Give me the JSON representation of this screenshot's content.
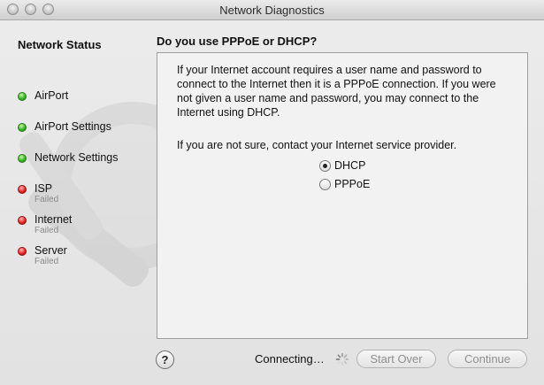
{
  "window": {
    "title": "Network Diagnostics"
  },
  "sidebar": {
    "header": "Network Status",
    "items": [
      {
        "label": "AirPort",
        "status": "ok",
        "sub": ""
      },
      {
        "label": "AirPort Settings",
        "status": "ok",
        "sub": ""
      },
      {
        "label": "Network Settings",
        "status": "ok",
        "sub": ""
      },
      {
        "label": "ISP",
        "status": "failed",
        "sub": "Failed"
      },
      {
        "label": "Internet",
        "status": "failed",
        "sub": "Failed"
      },
      {
        "label": "Server",
        "status": "failed",
        "sub": "Failed"
      }
    ]
  },
  "main": {
    "heading": "Do you use PPPoE or DHCP?",
    "paragraph1": "If your Internet account requires a user name and password to connect to the Internet then it is a PPPoE connection. If you were not given a user name and password, you may connect to the Internet using DHCP.",
    "paragraph2": "If you are not sure, contact your Internet service provider.",
    "options": [
      {
        "label": "DHCP",
        "selected": true
      },
      {
        "label": "PPPoE",
        "selected": false
      }
    ]
  },
  "footer": {
    "help_label": "?",
    "status_text": "Connecting…",
    "start_over_label": "Start Over",
    "continue_label": "Continue"
  },
  "colors": {
    "ok": "#2fb11e",
    "failed": "#e32121"
  },
  "icons": {
    "help": "question-mark-icon",
    "spinner": "spinner-icon",
    "watermark": "network-diagnostics-watermark-icon"
  }
}
